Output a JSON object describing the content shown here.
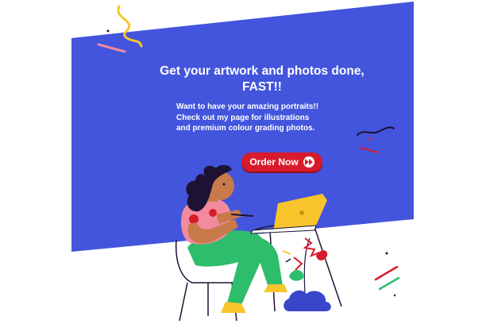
{
  "banner": {
    "headline_line1": "Get your artwork and photos done,",
    "headline_line2": "FAST!!",
    "body_lines": [
      "Want to have your amazing portraits!!",
      "Check out my page for illustrations",
      "and premium colour grading photos."
    ],
    "cta_label": "Order Now",
    "cta_icon": "fast-forward-icon"
  },
  "colors": {
    "banner_blue": "#4355dc",
    "cta_red": "#d81b2c",
    "laptop_yellow": "#f7c52b",
    "pants_green": "#2ebd6b",
    "shirt_pink": "#f28aa0",
    "skin": "#c97a4a",
    "hair": "#1d1234",
    "plant_blue": "#3946c9"
  },
  "illustration": {
    "subject": "woman-drawing-on-laptop",
    "decorations": [
      "yellow-squiggle",
      "confetti-lines",
      "plant-with-red-flowers",
      "blue-cloud-pot"
    ]
  }
}
